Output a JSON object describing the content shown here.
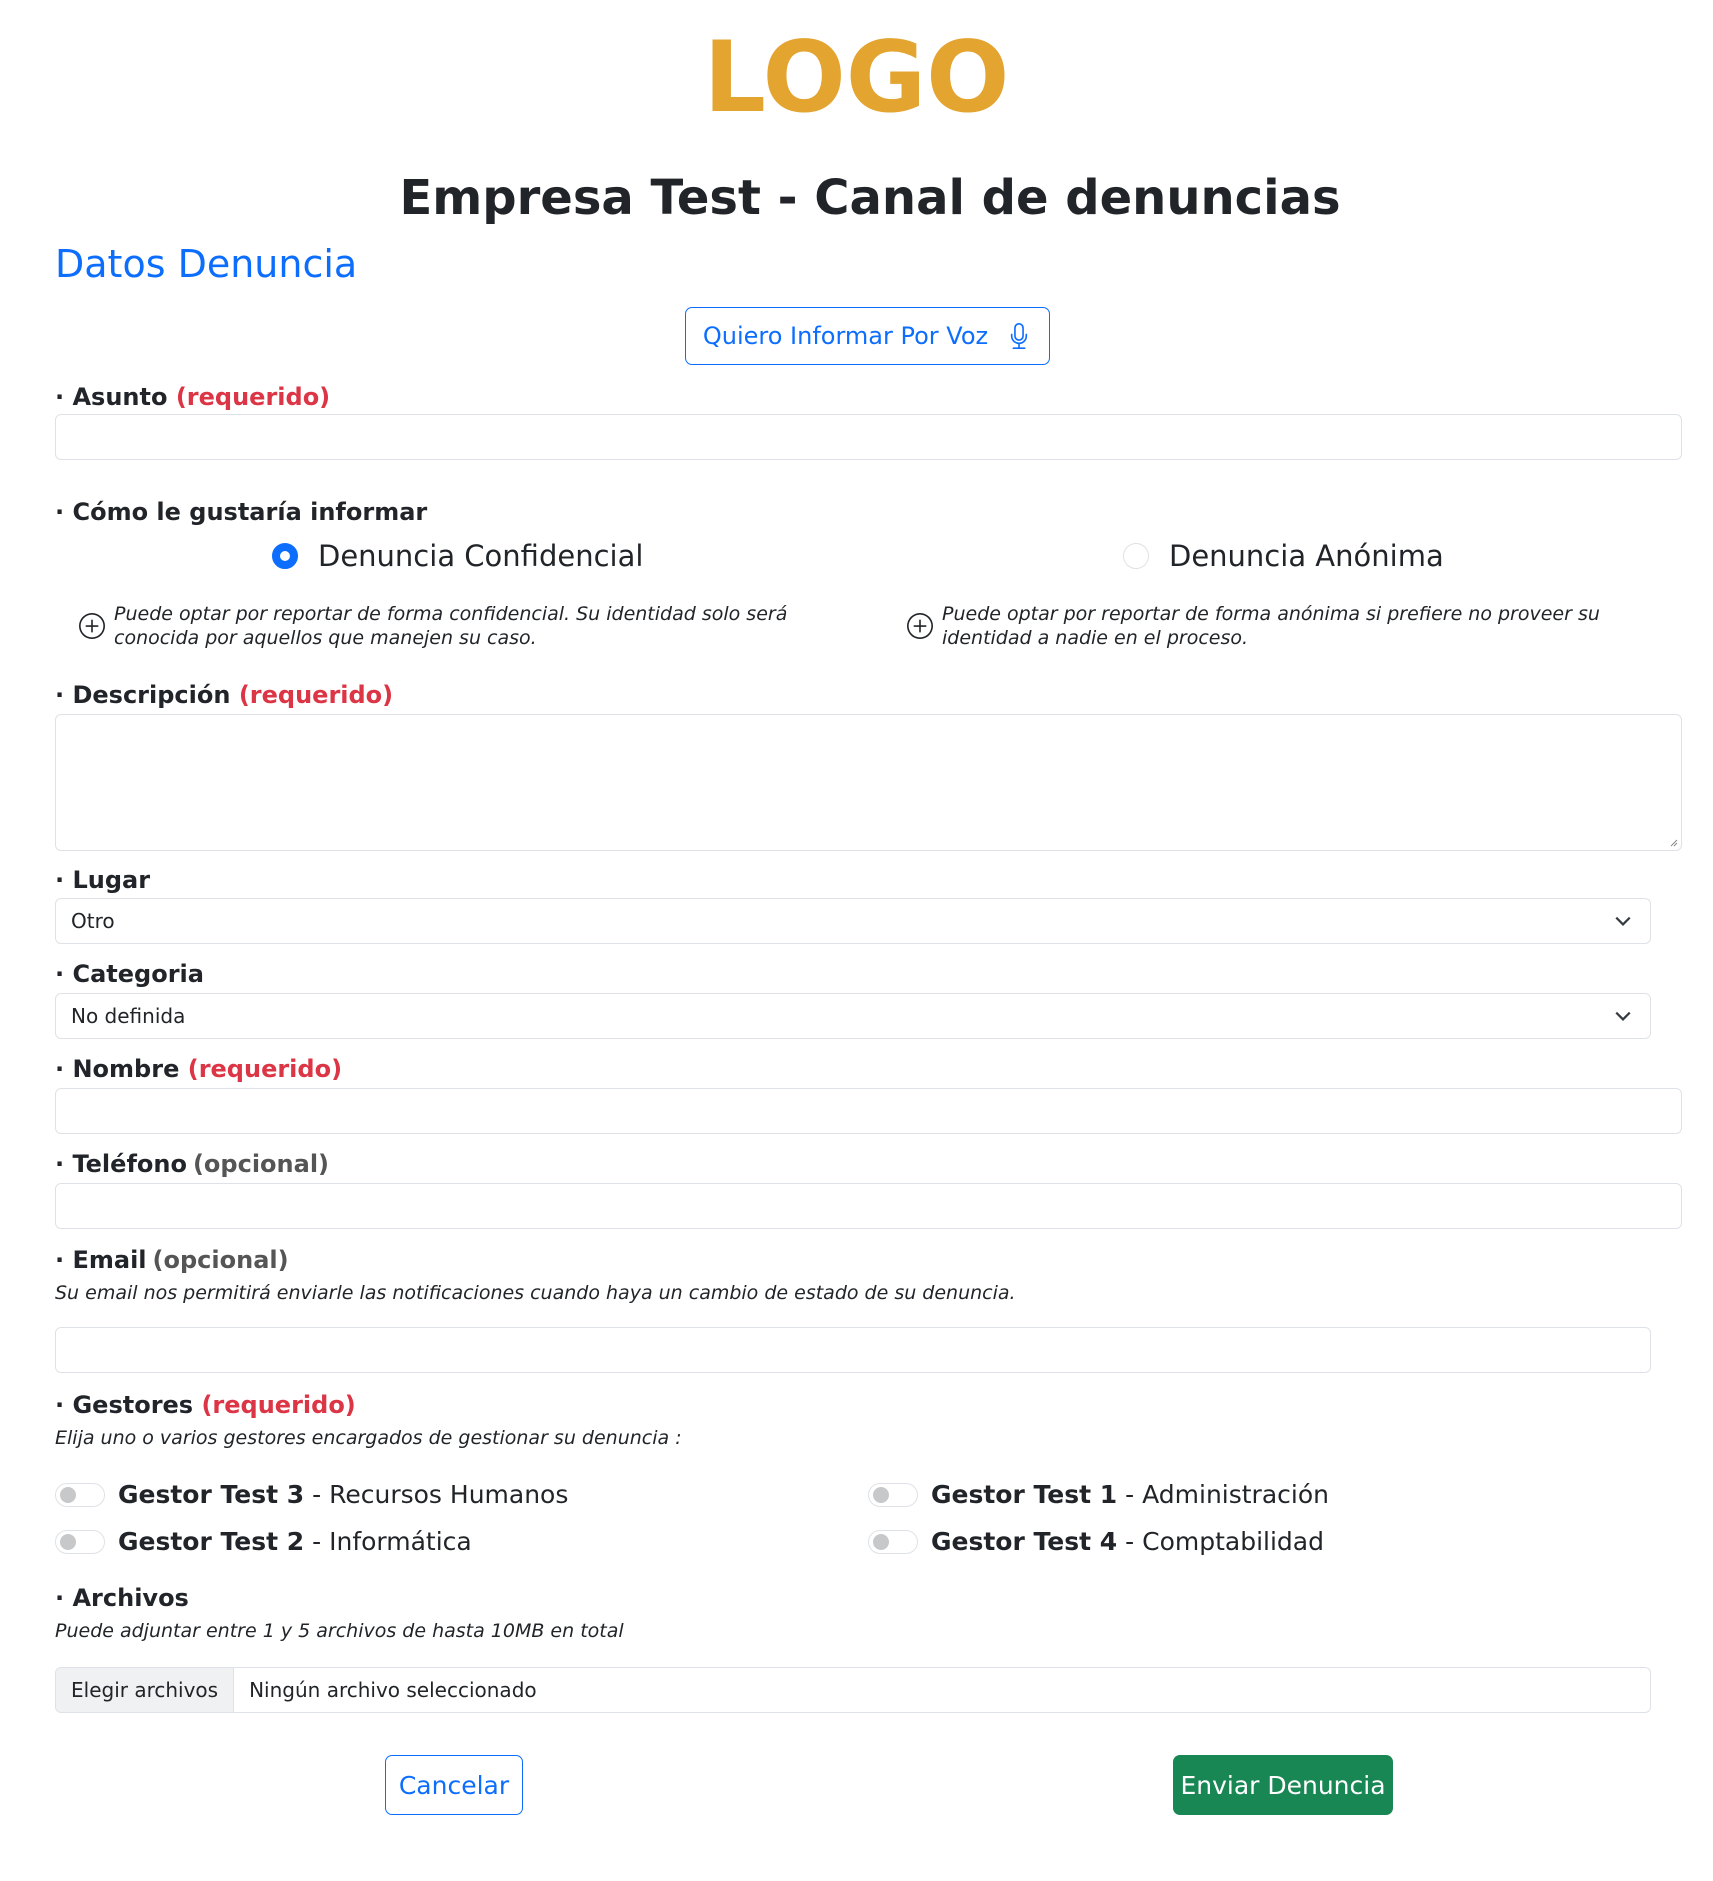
{
  "logo": {
    "text": "LOGO"
  },
  "header": {
    "title": "Empresa Test - Canal de denuncias"
  },
  "section": {
    "title": "Datos Denuncia"
  },
  "voice_button": {
    "label": "Quiero Informar Por Voz",
    "icon": "microphone-icon"
  },
  "asunto": {
    "bullet": "· Asunto",
    "required": "(requerido)",
    "value": ""
  },
  "modo": {
    "label": "· Cómo le gustaría informar",
    "options": [
      {
        "label": "Denuncia Confidencial",
        "selected": true,
        "hint": "Puede optar por reportar de forma confidencial. Su identidad solo será conocida por aquellos que manejen su caso."
      },
      {
        "label": "Denuncia Anónima",
        "selected": false,
        "hint": "Puede optar por reportar de forma anónima si prefiere no proveer su identidad a nadie en el proceso."
      }
    ]
  },
  "descripcion": {
    "bullet": "· Descripción",
    "required": "(requerido)",
    "value": ""
  },
  "lugar": {
    "label": "· Lugar",
    "selected": "Otro"
  },
  "categoria": {
    "label": "· Categoria",
    "selected": "No definida"
  },
  "nombre": {
    "bullet": "· Nombre",
    "required": "(requerido)",
    "value": ""
  },
  "telefono": {
    "bullet": "· Teléfono",
    "optional": "(opcional)",
    "value": ""
  },
  "email": {
    "bullet": "· Email",
    "optional": "(opcional)",
    "value": "",
    "note": "Su email nos permitirá enviarle las notificaciones cuando haya un cambio de estado de su denuncia."
  },
  "gestores": {
    "bullet": "· Gestores",
    "required": "(requerido)",
    "note": "Elija uno o varios gestores encargados de gestionar su denuncia :",
    "items": [
      {
        "name": "Gestor Test 3",
        "dept": "- Recursos Humanos",
        "checked": false
      },
      {
        "name": "Gestor Test 1",
        "dept": "- Administración",
        "checked": false
      },
      {
        "name": "Gestor Test 2",
        "dept": "- Informática",
        "checked": false
      },
      {
        "name": "Gestor Test 4",
        "dept": "- Comptabilidad",
        "checked": false
      }
    ]
  },
  "archivos": {
    "label": "· Archivos",
    "note": "Puede adjuntar entre 1 y 5 archivos de hasta 10MB en total",
    "button": "Elegir archivos",
    "status": "Ningún archivo seleccionado"
  },
  "actions": {
    "cancel": "Cancelar",
    "submit": "Enviar Denuncia"
  },
  "colors": {
    "accent": "#0d6efd",
    "required": "#dc3545",
    "success": "#198754",
    "logo": "#e3a430"
  }
}
